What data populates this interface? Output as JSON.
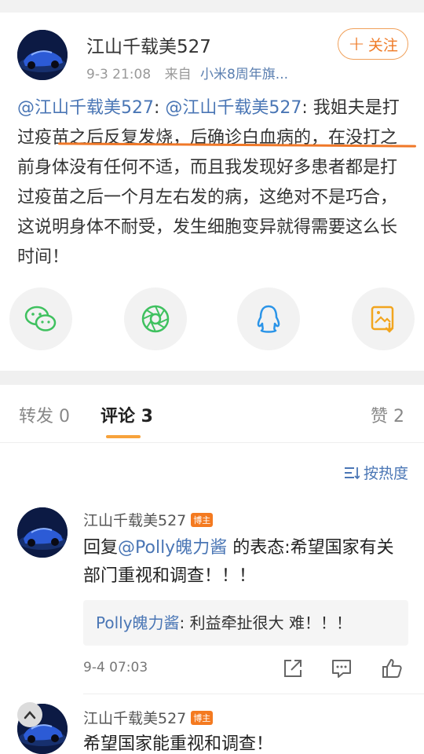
{
  "post": {
    "author": "江山千载美527",
    "date": "9-3 21:08",
    "source_prefix": "来自",
    "source": "小米8周年旗...",
    "follow_plus": "+",
    "follow_label": "关注",
    "text_mention1": "@江山千载美527",
    "text_sep": ": ",
    "text_mention2": "@江山千载美527",
    "text_body": ": 我姐夫是打过疫苗之后反复发烧，后确诊白血病的，在没打之前身体没有任何不适，而且我发现好多患者都是打过疫苗之后一个月左右发的病，这绝对不是巧合，这说明身体不耐受，发生细胞变异就得需要这么长时间！"
  },
  "share": {
    "icons": [
      "wechat-icon",
      "moments-icon",
      "qq-icon",
      "save-image-icon"
    ],
    "colors": {
      "wechat": "#3fc15f",
      "moments": "#3fc15f",
      "qq": "#2a94e8",
      "save": "#f2a51f"
    }
  },
  "tabs": {
    "repost": "转发 0",
    "comments": "评论 3",
    "likes": "赞 2"
  },
  "sort": {
    "label": "按热度"
  },
  "comments": [
    {
      "name": "江山千载美527",
      "badge": "博主",
      "reply_prefix": "回复",
      "reply_mention": "@Polly魄力酱",
      "reply_text": " 的表态:希望国家有关部门重视和调查！！！",
      "quote_name": "Polly魄力酱",
      "quote_text": ": 利益牵扯很大 难！！！",
      "time": "9-4 07:03"
    },
    {
      "name": "江山千载美527",
      "badge": "博主",
      "text": "希望国家能重视和调查！"
    }
  ],
  "colors": {
    "accent": "#ef7a26",
    "link": "#4a76b5",
    "indicator": "#f7a23b"
  }
}
